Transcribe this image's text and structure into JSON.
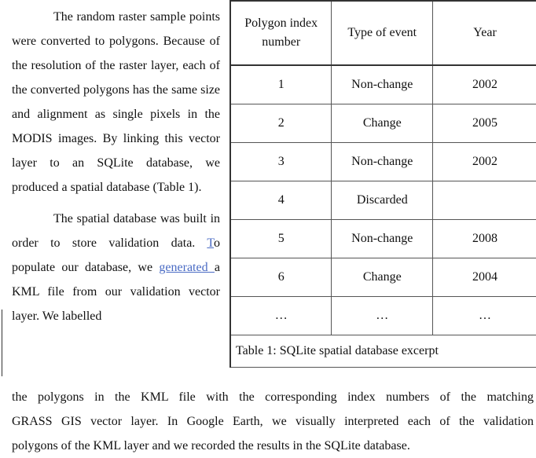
{
  "paragraph1": {
    "lines": [
      "The random raster sample",
      "points were converted to polygons.",
      "Because of the resolution of the",
      "raster layer, each of the converted",
      "polygons has the same size and",
      "alignment as single pixels in the",
      "MODIS images. By linking this",
      "vector layer to an SQLite database,",
      "we produced a spatial database",
      "(Table 1)."
    ]
  },
  "paragraph2": {
    "line1": "The spatial database was",
    "line2": "built in order to store validation",
    "line3_pre": "data. ",
    "line3_link": "T",
    "line3_post": "o populate our database, we",
    "line4_link": "generated ",
    "line4_post": "a KML file from our",
    "line5": "validation vector layer. We labelled"
  },
  "table": {
    "headers": [
      "Polygon index number",
      "Type of event",
      "Year"
    ],
    "rows": [
      [
        "1",
        "Non-change",
        "2002"
      ],
      [
        "2",
        "Change",
        "2005"
      ],
      [
        "3",
        "Non-change",
        "2002"
      ],
      [
        "4",
        "Discarded",
        ""
      ],
      [
        "5",
        "Non-change",
        "2008"
      ],
      [
        "6",
        "Change",
        "2004"
      ],
      [
        "…",
        "…",
        "…"
      ]
    ],
    "caption": "Table 1: SQLite spatial database excerpt"
  },
  "continuation": {
    "lines": [
      "the polygons in the KML file with the corresponding index numbers of the matching",
      "GRASS GIS vector layer. In Google Earth, we visually interpreted each of the validation",
      "polygons of the KML layer and we recorded the results in the SQLite database."
    ]
  },
  "colors": {
    "link": "#4a6bc4",
    "text": "#111111",
    "border": "#555555"
  }
}
